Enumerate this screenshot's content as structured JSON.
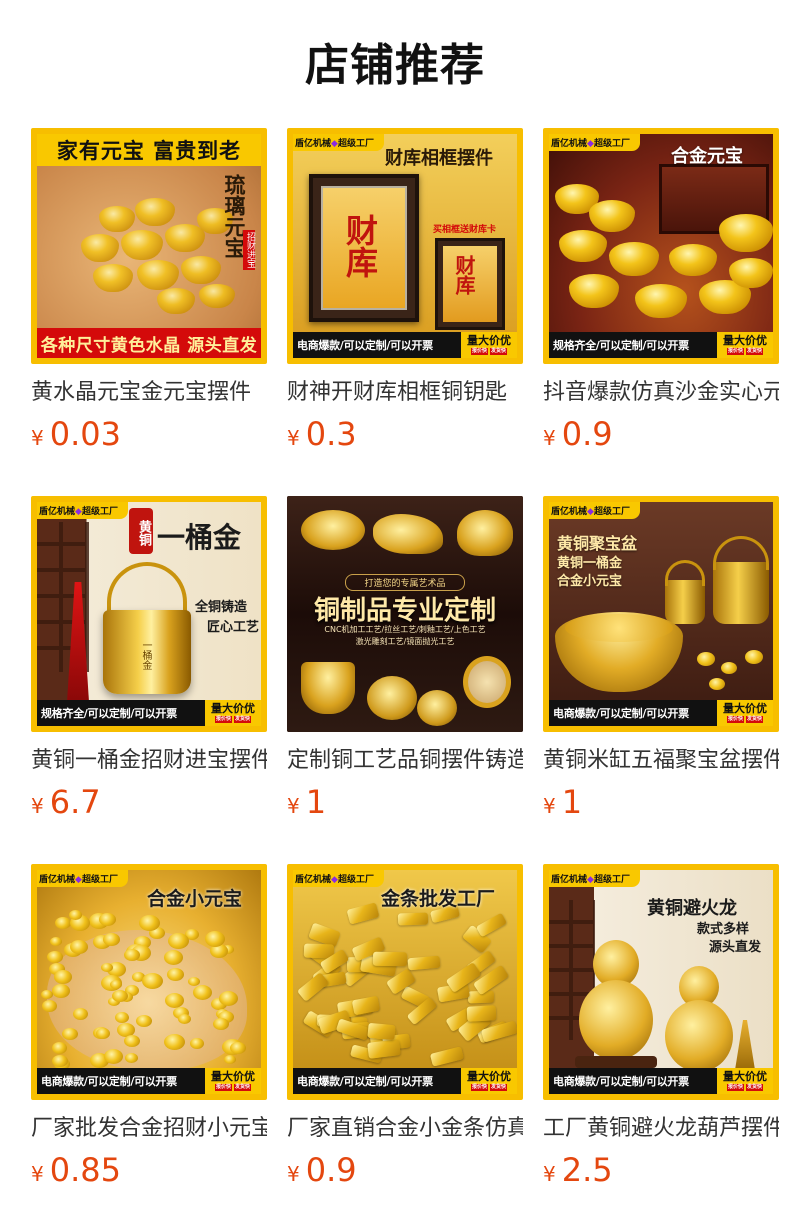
{
  "page": {
    "title": "店铺推荐"
  },
  "currency": "¥",
  "colors": {
    "price": "#e4470f",
    "banner_yellow": "#f9c800",
    "banner_red": "#d40a0a"
  },
  "products": [
    {
      "name": "黄水晶元宝金元宝摆件",
      "price": "0.03",
      "image": {
        "top_banner": "家有元宝  富贵到老",
        "bottom_banner": "各种尺寸黄色水晶  源头直发",
        "overlay": "琉璃元宝",
        "side_tag": "招财进宝"
      }
    },
    {
      "name": "财神开财库相框铜钥匙",
      "price": "0.3",
      "image": {
        "brand": "盾亿机械",
        "brand_suffix": "超级工厂",
        "overlay": "财库相框摆件",
        "frame_text": "财库",
        "note": "买相框送财库卡",
        "promo": "电商爆款/可以定制/可以开票",
        "badge": "量大价优",
        "badge_sub1": "报价快",
        "badge_sub2": "发货快"
      }
    },
    {
      "name": "抖音爆款仿真沙金实心元宝",
      "price": "0.9",
      "image": {
        "brand": "盾亿机械",
        "brand_suffix": "超级工厂",
        "overlay": "合金元宝",
        "promo": "规格齐全/可以定制/可以开票",
        "badge": "量大价优",
        "badge_sub1": "报价快",
        "badge_sub2": "发货快"
      }
    },
    {
      "name": "黄铜一桶金招财进宝摆件",
      "price": "6.7",
      "image": {
        "brand": "盾亿机械",
        "brand_suffix": "超级工厂",
        "tag": "黄铜",
        "overlay": "一桶金",
        "line1": "全铜铸造",
        "line2": "匠心工艺",
        "bucket_text": "一桶金",
        "promo": "规格齐全/可以定制/可以开票",
        "badge": "量大价优",
        "badge_sub1": "报价快",
        "badge_sub2": "发货快"
      }
    },
    {
      "name": "定制铜工艺品铜摆件铸造",
      "price": "1",
      "image": {
        "ribbon": "打造您的专属艺术品",
        "overlay": "铜制品专业定制",
        "line1": "CNC机加工工艺/拉丝工艺/刺釉工艺/上色工艺",
        "line2": "激光雕刻工艺/镜面抛光工艺"
      }
    },
    {
      "name": "黄铜米缸五福聚宝盆摆件",
      "price": "1",
      "image": {
        "brand": "盾亿机械",
        "brand_suffix": "超级工厂",
        "overlay": "黄铜聚宝盆",
        "line1": "黄铜一桶金",
        "line2": "合金小元宝",
        "promo": "电商爆款/可以定制/可以开票",
        "badge": "量大价优",
        "badge_sub1": "报价快",
        "badge_sub2": "发货快"
      }
    },
    {
      "name": "厂家批发合金招财小元宝",
      "price": "0.85",
      "image": {
        "brand": "盾亿机械",
        "brand_suffix": "超级工厂",
        "overlay": "合金小元宝",
        "promo": "电商爆款/可以定制/可以开票",
        "badge": "量大价优",
        "badge_sub1": "报价快",
        "badge_sub2": "发货快"
      }
    },
    {
      "name": "厂家直销合金小金条仿真",
      "price": "0.9",
      "image": {
        "brand": "盾亿机械",
        "brand_suffix": "超级工厂",
        "overlay": "金条批发工厂",
        "promo": "电商爆款/可以定制/可以开票",
        "badge": "量大价优",
        "badge_sub1": "报价快",
        "badge_sub2": "发货快"
      }
    },
    {
      "name": "工厂黄铜避火龙葫芦摆件",
      "price": "2.5",
      "image": {
        "brand": "盾亿机械",
        "brand_suffix": "超级工厂",
        "overlay": "黄铜避火龙",
        "line1": "款式多样",
        "line2": "源头直发",
        "promo": "电商爆款/可以定制/可以开票",
        "badge": "量大价优",
        "badge_sub1": "报价快",
        "badge_sub2": "发货快"
      }
    }
  ]
}
